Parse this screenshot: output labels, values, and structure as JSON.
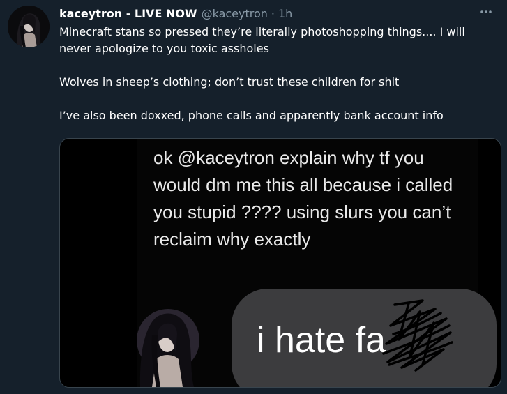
{
  "tweet": {
    "author_name": "kaceytron - LIVE NOW",
    "author_handle": "@kaceytron",
    "separator": "·",
    "timestamp": "1h",
    "paragraphs": [
      "Minecraft stans so pressed they’re literally photoshopping things.... I will never apologize to you toxic assholes",
      "Wolves in sheep’s clothing; don’t trust these children for shit",
      "I’ve also been doxxed, phone calls and apparently bank account info"
    ]
  },
  "media": {
    "screenshot_message": "ok @kaceytron explain why tf you would dm me this all because i called you stupid ???? using slurs you can’t reclaim why exactly",
    "bubble_text": "i hate fa"
  },
  "icons": {
    "more": "more-horizontal-icon",
    "avatar": "profile-photo",
    "redaction": "scribble-redaction"
  },
  "colors": {
    "background": "#15202b",
    "primary_text": "#ffffff",
    "secondary_text": "#8899a6",
    "border": "#38444d",
    "bubble": "#3c3c3e"
  }
}
